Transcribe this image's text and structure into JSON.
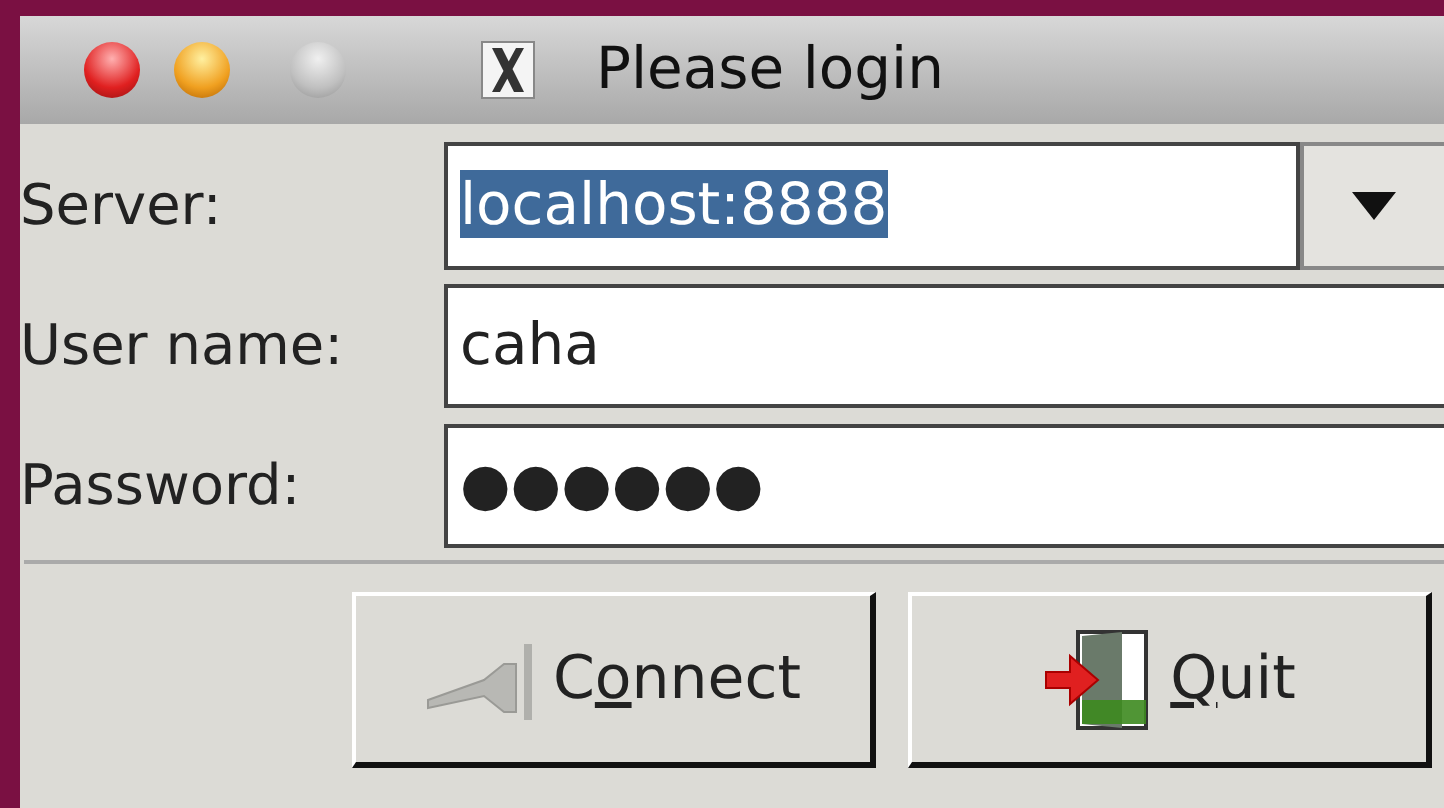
{
  "window": {
    "title": "Please login"
  },
  "fields": [
    {
      "kind": "combo",
      "label": "Server:",
      "value": "localhost:8888",
      "text_selected": true
    },
    {
      "kind": "text",
      "label": "User name:",
      "value": "caha",
      "text_selected": false
    },
    {
      "kind": "text",
      "label": "Password:",
      "value": "●●●●●●",
      "text_selected": false
    }
  ],
  "buttons": [
    {
      "kind": "connect",
      "before": "C",
      "key": "o",
      "after": "nnect"
    },
    {
      "kind": "quit",
      "key": "Q",
      "after": "uit"
    }
  ]
}
